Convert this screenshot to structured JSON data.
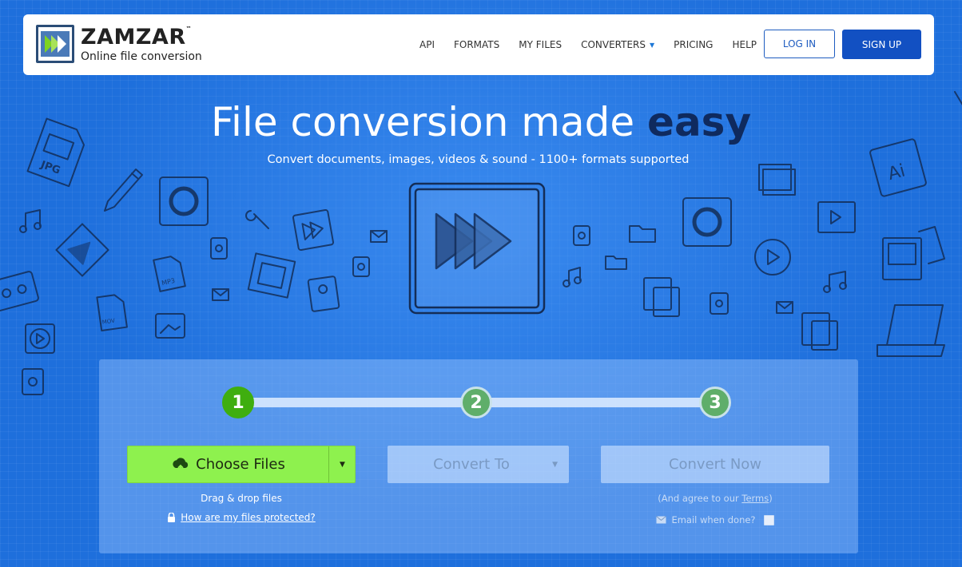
{
  "brand": {
    "name": "ZAMZAR",
    "tm": "™",
    "tagline": "Online file conversion"
  },
  "nav": {
    "links": [
      "API",
      "FORMATS",
      "MY FILES",
      "CONVERTERS",
      "PRICING",
      "HELP"
    ],
    "login_label": "LOG IN",
    "signup_label": "SIGN UP"
  },
  "hero": {
    "title_part1": "File conversion made ",
    "title_part2": "easy",
    "subtitle": "Convert documents, images, videos & sound - 1100+ formats supported"
  },
  "steps": [
    "1",
    "2",
    "3"
  ],
  "converter": {
    "choose_files_label": "Choose Files",
    "convert_to_label": "Convert To",
    "convert_now_label": "Convert Now",
    "drag_drop_text": "Drag & drop files",
    "protected_link": "How are my files protected?",
    "agree_prefix": "(And agree to our ",
    "terms_label": "Terms",
    "agree_suffix": ")",
    "email_label": "Email when done?"
  },
  "icon_labels": {
    "jpg": "JPG",
    "mp3": "MP3",
    "mov": "MOV",
    "ai": "Ai"
  },
  "colors": {
    "background": "#1e6fdc",
    "navy": "#0f2a5e",
    "accent_green": "#8ef14e",
    "step_green": "#3fae0f",
    "signup_blue": "#1250c2"
  }
}
